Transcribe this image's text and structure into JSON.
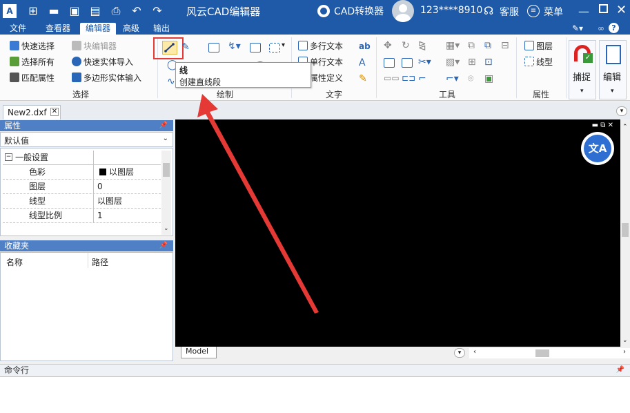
{
  "app": {
    "title": "风云CAD编辑器",
    "converter": "CAD转换器",
    "user": "123****8910",
    "service": "客服",
    "menu": "菜单"
  },
  "menu_tabs": [
    "文件",
    "查看器",
    "编辑器",
    "高级",
    "输出"
  ],
  "ribbon": {
    "select": {
      "quick_select": "快速选择",
      "block_editor": "块编辑器",
      "select_all": "选择所有",
      "quick_entity_import": "快速实体导入",
      "match_props": "匹配属性",
      "polygon_entity_input": "多边形实体输入",
      "label": "选择"
    },
    "draw": {
      "label": "绘制"
    },
    "text": {
      "mtext": "多行文本",
      "stext": "单行文本",
      "attr_def": "属性定义",
      "label": "文字"
    },
    "tools": {
      "label": "工具"
    },
    "props": {
      "layer": "图层",
      "linetype": "线型",
      "label": "属性"
    },
    "snap": "捕捉",
    "edit": "编辑"
  },
  "tooltip": {
    "title": "线",
    "desc": "创建直线段"
  },
  "doc_tab": "New2.dxf",
  "props_panel": {
    "title": "属性",
    "dropdown": "默认值",
    "section": "一般设置",
    "rows": [
      {
        "k": "色彩",
        "v": "以图层"
      },
      {
        "k": "图层",
        "v": "0"
      },
      {
        "k": "线型",
        "v": "以图层"
      },
      {
        "k": "线型比例",
        "v": "1"
      }
    ]
  },
  "fav_panel": {
    "title": "收藏夹",
    "col_name": "名称",
    "col_path": "路径"
  },
  "model_tab": "Model",
  "cmd_panel": {
    "title": "命令行"
  },
  "colors": {
    "accent": "#1e5aa8",
    "highlight": "#e53935",
    "canvas": "#000000"
  }
}
